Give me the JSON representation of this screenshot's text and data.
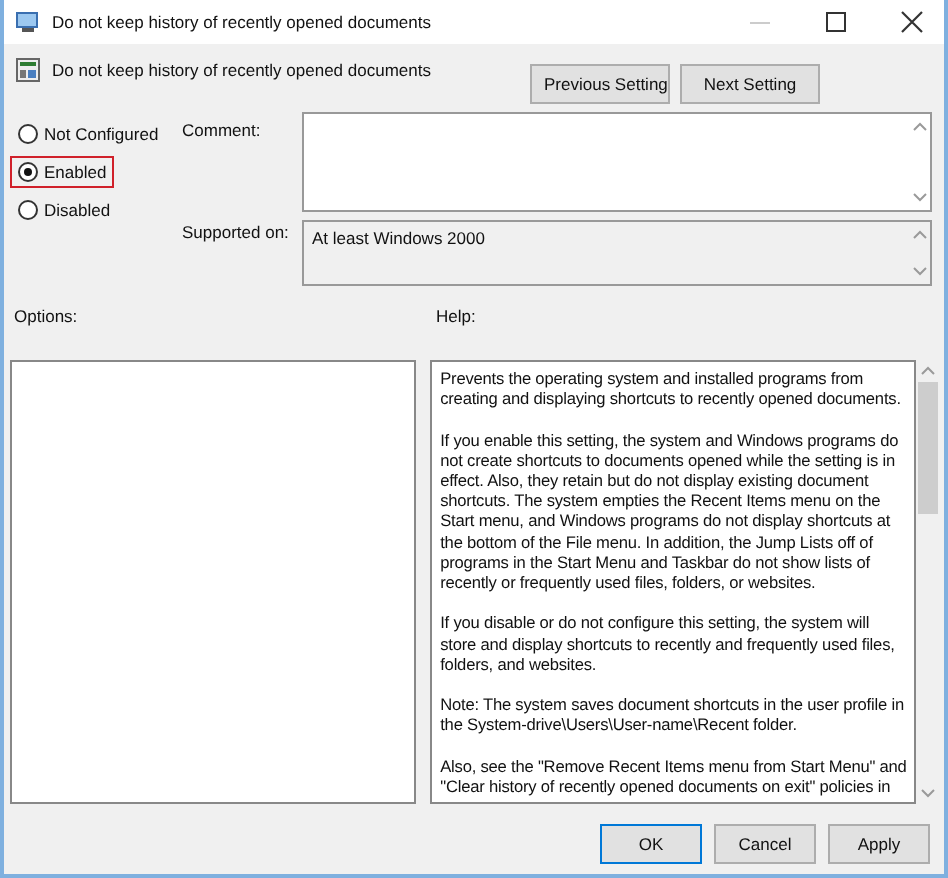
{
  "window": {
    "title": "Do not keep history of recently opened documents"
  },
  "policy": {
    "name": "Do not keep history of recently opened documents"
  },
  "nav_buttons": [
    "Previous Setting",
    "Next Setting"
  ],
  "states": [
    {
      "label": "Not Configured",
      "selected": false,
      "highlighted": false
    },
    {
      "label": "Enabled",
      "selected": true,
      "highlighted": true
    },
    {
      "label": "Disabled",
      "selected": false,
      "highlighted": false
    }
  ],
  "comment": {
    "label": "Comment:"
  },
  "supported_on": {
    "label": "Supported on:",
    "value": "At least Windows 2000"
  },
  "options": {
    "label": "Options:"
  },
  "help": {
    "label": "Help:",
    "paragraphs": [
      "Prevents the operating system and installed programs from creating and displaying shortcuts to recently opened documents.",
      "If you enable this setting, the system and Windows programs do not create shortcuts to documents opened while the setting is in effect. Also, they retain but do not display existing document shortcuts. The system empties the Recent Items menu on the Start menu, and Windows programs do not display shortcuts at the bottom of the File menu. In addition, the Jump Lists off of programs in the Start Menu and Taskbar do not show lists of recently or frequently used files, folders, or websites.",
      "If you disable or do not configure this setting, the system will store and display shortcuts to recently and frequently used files, folders, and websites.",
      "Note: The system saves document shortcuts in the user profile in the System-drive\\Users\\User-name\\Recent folder.",
      "Also, see the \"Remove Recent Items menu from Start Menu\" and \"Clear history of recently opened documents on exit\" policies in"
    ]
  },
  "buttons": [
    {
      "label": "OK",
      "default": true
    },
    {
      "label": "Cancel",
      "default": false
    },
    {
      "label": "Apply",
      "default": false
    }
  ]
}
